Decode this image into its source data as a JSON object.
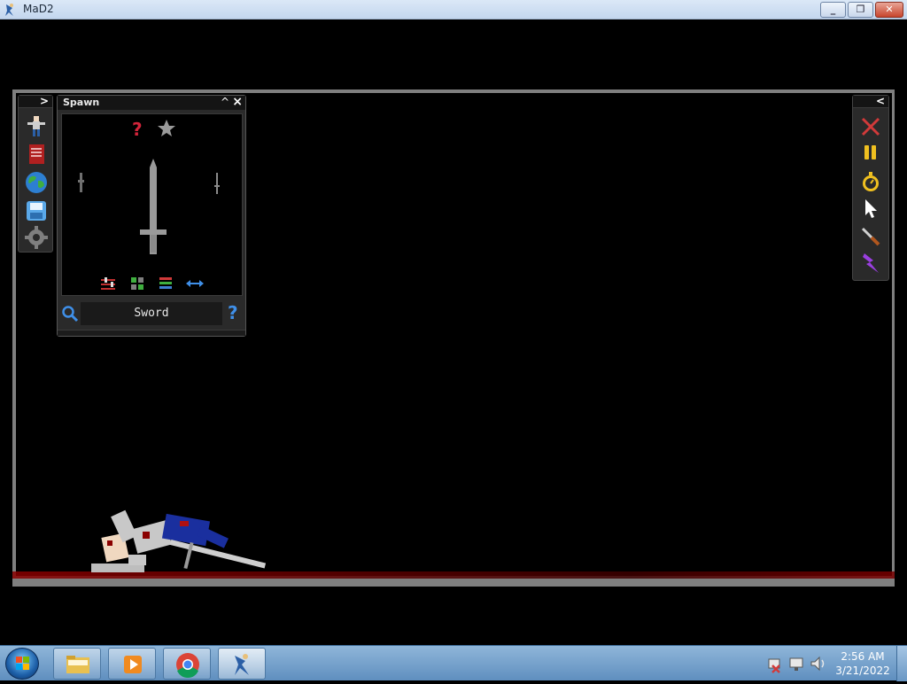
{
  "window": {
    "title": "MaD2",
    "icon": "mad2-app-icon",
    "buttons": [
      "minimize-icon",
      "maximize-icon",
      "close-icon"
    ]
  },
  "left_toolbar": {
    "toggle_icon": "chevron-right-icon",
    "items": [
      {
        "name": "character-icon"
      },
      {
        "name": "book-icon"
      },
      {
        "name": "globe-icon"
      },
      {
        "name": "save-icon"
      },
      {
        "name": "gear-icon"
      }
    ]
  },
  "spawn": {
    "title": "Spawn",
    "collapse_icon": "chevron-up-icon",
    "close_icon": "close-icon",
    "top_icons": [
      "question-icon",
      "star-icon"
    ],
    "preview_items": [
      "dagger-small-icon",
      "sword-icon",
      "needle-icon"
    ],
    "bottom_icons": [
      "sliders-icon",
      "grid-icon",
      "list-icon",
      "swap-arrows-icon"
    ],
    "search_value": "Sword",
    "help_label": "?"
  },
  "right_toolbar": {
    "toggle_icon": "chevron-left-icon",
    "items": [
      {
        "name": "delete-x-icon"
      },
      {
        "name": "pause-icon"
      },
      {
        "name": "stopwatch-icon"
      },
      {
        "name": "cursor-icon"
      },
      {
        "name": "knife-icon"
      },
      {
        "name": "lightning-icon"
      }
    ]
  },
  "taskbar": {
    "start": "windows-start-orb",
    "pinned": [
      "file-explorer-icon",
      "media-player-icon",
      "chrome-icon",
      "mad2-app-icon"
    ],
    "tray_icons": [
      "network-x-icon",
      "monitor-icon",
      "volume-icon"
    ],
    "time": "2:56 AM",
    "date": "3/21/2022"
  },
  "colors": {
    "frame_gray": "#7f7f7f",
    "panel_bg": "#2a2a2a",
    "blood_red": "#8a0000",
    "accent_blue": "#3f8fe8"
  }
}
